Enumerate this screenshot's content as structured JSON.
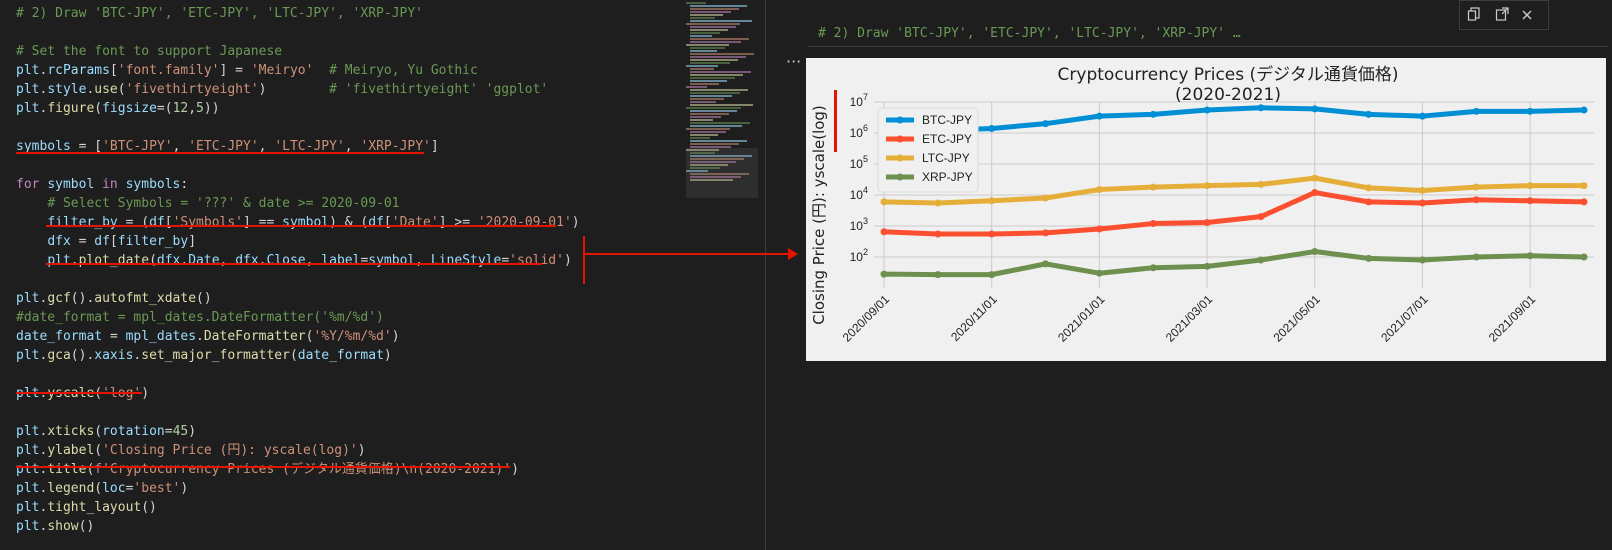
{
  "editor": {
    "lines": [
      [
        [
          "comment",
          "# 2) Draw 'BTC-JPY', 'ETC-JPY', 'LTC-JPY', 'XRP-JPY'"
        ]
      ],
      [],
      [
        [
          "comment",
          "# Set the font to support Japanese"
        ]
      ],
      [
        [
          "var",
          "plt"
        ],
        [
          "plain",
          "."
        ],
        [
          "var",
          "rcParams"
        ],
        [
          "plain",
          "["
        ],
        [
          "string",
          "'font.family'"
        ],
        [
          "plain",
          "] = "
        ],
        [
          "string",
          "'Meiryo'"
        ],
        [
          "plain",
          "  "
        ],
        [
          "comment",
          "# Meiryo, Yu Gothic"
        ]
      ],
      [
        [
          "var",
          "plt"
        ],
        [
          "plain",
          "."
        ],
        [
          "var",
          "style"
        ],
        [
          "plain",
          "."
        ],
        [
          "func",
          "use"
        ],
        [
          "plain",
          "("
        ],
        [
          "string",
          "'fivethirtyeight'"
        ],
        [
          "plain",
          ")        "
        ],
        [
          "comment",
          "# 'fivethirtyeight' 'ggplot'"
        ]
      ],
      [
        [
          "var",
          "plt"
        ],
        [
          "plain",
          "."
        ],
        [
          "func",
          "figure"
        ],
        [
          "plain",
          "("
        ],
        [
          "var",
          "figsize"
        ],
        [
          "plain",
          "=("
        ],
        [
          "num",
          "12"
        ],
        [
          "plain",
          ","
        ],
        [
          "num",
          "5"
        ],
        [
          "plain",
          "))"
        ]
      ],
      [],
      [
        [
          "var",
          "symbols"
        ],
        [
          "plain",
          " = ["
        ],
        [
          "string",
          "'BTC-JPY'"
        ],
        [
          "plain",
          ", "
        ],
        [
          "string",
          "'ETC-JPY'"
        ],
        [
          "plain",
          ", "
        ],
        [
          "string",
          "'LTC-JPY'"
        ],
        [
          "plain",
          ", "
        ],
        [
          "string",
          "'XRP-JPY'"
        ],
        [
          "plain",
          "]"
        ]
      ],
      [],
      [
        [
          "keyword",
          "for"
        ],
        [
          "plain",
          " "
        ],
        [
          "var",
          "symbol"
        ],
        [
          "plain",
          " "
        ],
        [
          "keyword",
          "in"
        ],
        [
          "plain",
          " "
        ],
        [
          "var",
          "symbols"
        ],
        [
          "plain",
          ":"
        ]
      ],
      [
        [
          "plain",
          "    "
        ],
        [
          "comment",
          "# Select Symbols = '???' & date >= 2020-09-01"
        ]
      ],
      [
        [
          "plain",
          "    "
        ],
        [
          "var",
          "filter_by"
        ],
        [
          "plain",
          " = ("
        ],
        [
          "var",
          "df"
        ],
        [
          "plain",
          "["
        ],
        [
          "string",
          "'Symbols'"
        ],
        [
          "plain",
          "] == "
        ],
        [
          "var",
          "symbol"
        ],
        [
          "plain",
          ") & ("
        ],
        [
          "var",
          "df"
        ],
        [
          "plain",
          "["
        ],
        [
          "string",
          "'Date'"
        ],
        [
          "plain",
          "] >= "
        ],
        [
          "string",
          "'2020-09-01'"
        ],
        [
          "plain",
          ")"
        ]
      ],
      [
        [
          "plain",
          "    "
        ],
        [
          "var",
          "dfx"
        ],
        [
          "plain",
          " = "
        ],
        [
          "var",
          "df"
        ],
        [
          "plain",
          "["
        ],
        [
          "var",
          "filter_by"
        ],
        [
          "plain",
          "]"
        ]
      ],
      [
        [
          "plain",
          "    "
        ],
        [
          "var",
          "plt"
        ],
        [
          "plain",
          "."
        ],
        [
          "func",
          "plot_date"
        ],
        [
          "plain",
          "("
        ],
        [
          "var",
          "dfx"
        ],
        [
          "plain",
          "."
        ],
        [
          "var",
          "Date"
        ],
        [
          "plain",
          ", "
        ],
        [
          "var",
          "dfx"
        ],
        [
          "plain",
          "."
        ],
        [
          "var",
          "Close"
        ],
        [
          "plain",
          ", "
        ],
        [
          "var",
          "label"
        ],
        [
          "plain",
          "="
        ],
        [
          "var",
          "symbol"
        ],
        [
          "plain",
          ", "
        ],
        [
          "var",
          "LineStyle"
        ],
        [
          "plain",
          "="
        ],
        [
          "string",
          "'solid'"
        ],
        [
          "plain",
          ")"
        ]
      ],
      [],
      [
        [
          "var",
          "plt"
        ],
        [
          "plain",
          "."
        ],
        [
          "func",
          "gcf"
        ],
        [
          "plain",
          "()."
        ],
        [
          "func",
          "autofmt_xdate"
        ],
        [
          "plain",
          "()"
        ]
      ],
      [
        [
          "comment",
          "#date_format = mpl_dates.DateFormatter('%m/%d')"
        ]
      ],
      [
        [
          "var",
          "date_format"
        ],
        [
          "plain",
          " = "
        ],
        [
          "var",
          "mpl_dates"
        ],
        [
          "plain",
          "."
        ],
        [
          "func",
          "DateFormatter"
        ],
        [
          "plain",
          "("
        ],
        [
          "string",
          "'%Y/%m/%d'"
        ],
        [
          "plain",
          ")"
        ]
      ],
      [
        [
          "var",
          "plt"
        ],
        [
          "plain",
          "."
        ],
        [
          "func",
          "gca"
        ],
        [
          "plain",
          "()."
        ],
        [
          "var",
          "xaxis"
        ],
        [
          "plain",
          "."
        ],
        [
          "func",
          "set_major_formatter"
        ],
        [
          "plain",
          "("
        ],
        [
          "var",
          "date_format"
        ],
        [
          "plain",
          ")"
        ]
      ],
      [],
      [
        [
          "var",
          "plt"
        ],
        [
          "plain",
          "."
        ],
        [
          "func",
          "yscale"
        ],
        [
          "plain",
          "("
        ],
        [
          "string",
          "'log'"
        ],
        [
          "plain",
          ")"
        ]
      ],
      [],
      [
        [
          "var",
          "plt"
        ],
        [
          "plain",
          "."
        ],
        [
          "func",
          "xticks"
        ],
        [
          "plain",
          "("
        ],
        [
          "var",
          "rotation"
        ],
        [
          "plain",
          "="
        ],
        [
          "num",
          "45"
        ],
        [
          "plain",
          ")"
        ]
      ],
      [
        [
          "var",
          "plt"
        ],
        [
          "plain",
          "."
        ],
        [
          "func",
          "ylabel"
        ],
        [
          "plain",
          "("
        ],
        [
          "string",
          "'Closing Price (円): yscale(log)'"
        ],
        [
          "plain",
          ")"
        ]
      ],
      [
        [
          "var",
          "plt"
        ],
        [
          "plain",
          "."
        ],
        [
          "func",
          "title"
        ],
        [
          "plain",
          "("
        ],
        [
          "keyword",
          "f"
        ],
        [
          "string",
          "'Cryptocurrency Prices (デジタル通貨価格)\\n(2020-2021)'"
        ],
        [
          "plain",
          ")"
        ]
      ],
      [
        [
          "var",
          "plt"
        ],
        [
          "plain",
          "."
        ],
        [
          "func",
          "legend"
        ],
        [
          "plain",
          "("
        ],
        [
          "var",
          "loc"
        ],
        [
          "plain",
          "="
        ],
        [
          "string",
          "'best'"
        ],
        [
          "plain",
          ")"
        ]
      ],
      [
        [
          "var",
          "plt"
        ],
        [
          "plain",
          "."
        ],
        [
          "func",
          "tight_layout"
        ],
        [
          "plain",
          "()"
        ]
      ],
      [
        [
          "var",
          "plt"
        ],
        [
          "plain",
          "."
        ],
        [
          "func",
          "show"
        ],
        [
          "plain",
          "()"
        ]
      ]
    ]
  },
  "output": {
    "cell_title": "# 2) Draw 'BTC-JPY', 'ETC-JPY', 'LTC-JPY', 'XRP-JPY' …",
    "more_glyph": "···",
    "toolbar": [
      "copy-icon",
      "open-in-editor-icon",
      "close-icon"
    ]
  },
  "chart_data": {
    "type": "line",
    "title": "Cryptocurrency Prices (デジタル通貨価格)\n(2020-2021)",
    "ylabel": "Closing Price (円): yscale(log)",
    "xlabel": "",
    "yscale": "log",
    "ylim": [
      10,
      10000000
    ],
    "yticks": [
      "10^2",
      "10^3",
      "10^4",
      "10^5",
      "10^6",
      "10^7"
    ],
    "x_tick_labels": [
      "2020/09/01",
      "2020/11/01",
      "2021/01/01",
      "2021/03/01",
      "2021/05/01",
      "2021/07/01",
      "2021/09/01"
    ],
    "legend_position": "upper-left",
    "grid": true,
    "x": [
      "2020/09/01",
      "2020/10/01",
      "2020/11/01",
      "2020/12/01",
      "2021/01/01",
      "2021/02/01",
      "2021/03/01",
      "2021/04/01",
      "2021/05/01",
      "2021/06/01",
      "2021/07/01",
      "2021/08/01",
      "2021/09/01",
      "2021/10/01"
    ],
    "series": [
      {
        "name": "BTC-JPY",
        "color": "#008fd5",
        "values": [
          1200000,
          1200000,
          1400000,
          2000000,
          3500000,
          4000000,
          5500000,
          6500000,
          6000000,
          4000000,
          3500000,
          5000000,
          5000000,
          5500000
        ]
      },
      {
        "name": "ETC-JPY",
        "color": "#fc4f30",
        "values": [
          650,
          550,
          550,
          600,
          800,
          1200,
          1300,
          2000,
          12000,
          6000,
          5500,
          7000,
          6500,
          6000
        ]
      },
      {
        "name": "LTC-JPY",
        "color": "#e5ae38",
        "values": [
          6000,
          5500,
          6500,
          8000,
          15000,
          18000,
          20000,
          22000,
          35000,
          17000,
          14000,
          18000,
          20000,
          20000
        ]
      },
      {
        "name": "XRP-JPY",
        "color": "#6d904f",
        "values": [
          28,
          27,
          27,
          60,
          30,
          45,
          50,
          80,
          150,
          90,
          80,
          100,
          110,
          100
        ]
      }
    ]
  }
}
